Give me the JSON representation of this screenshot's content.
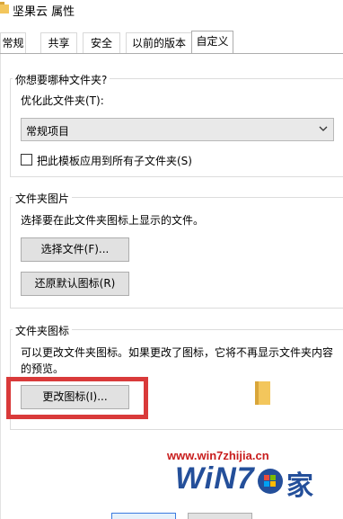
{
  "window": {
    "title": "坚果云 属性"
  },
  "tabs": [
    {
      "label": "常规",
      "active": false
    },
    {
      "label": "共享",
      "active": false
    },
    {
      "label": "安全",
      "active": false
    },
    {
      "label": "以前的版本",
      "active": false
    },
    {
      "label": "自定义",
      "active": true
    }
  ],
  "folder_type": {
    "heading": "你想要哪种文件夹?",
    "optimize_label": "优化此文件夹(T):",
    "selected_option": "常规项目",
    "apply_all_label": "把此模板应用到所有子文件夹(S)",
    "apply_all_checked": false
  },
  "folder_pictures": {
    "heading": "文件夹图片",
    "description": "选择要在此文件夹图标上显示的文件。",
    "choose_file_button": "选择文件(F)...",
    "restore_default_button": "还原默认图标(R)"
  },
  "folder_icons": {
    "heading": "文件夹图标",
    "description_line1": "可以更改文件夹图标。如果更改了图标，它将不再显示文件夹内容",
    "description_line2": "的预览。",
    "change_icon_button": "更改图标(I)..."
  },
  "watermark": {
    "url": "www.win7zhijia.cn",
    "logo_text": "WiN7",
    "logo_suffix": "家"
  },
  "colors": {
    "highlight": "#d93a3a",
    "watermark_url": "#c81d1d",
    "watermark_logo": "#244f9a"
  },
  "icons": {
    "title_icon": "folder-icon",
    "dropdown": "chevron-down-icon"
  }
}
